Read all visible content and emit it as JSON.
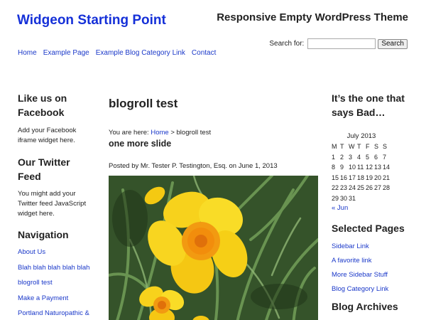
{
  "header": {
    "site_title": "Widgeon Starting Point",
    "tagline": "Responsive Empty WordPress Theme"
  },
  "search": {
    "label": "Search for:",
    "placeholder": "",
    "button_label": "Search"
  },
  "nav": {
    "items": [
      "Home",
      "Example Page",
      "Example Blog Category Link",
      "Contact"
    ]
  },
  "left_sidebar": {
    "facebook_title": "Like us on Facebook",
    "facebook_text": "Add your Facebook iframe widget here.",
    "twitter_title": "Our Twitter Feed",
    "twitter_text": "You might add your Twitter feed JavaScript widget here.",
    "navigation_title": "Navigation",
    "navigation_items": [
      "About Us",
      "Blah blah blah blah blah",
      "blogroll test",
      "Make a Payment",
      "Portland Naturopathic &"
    ]
  },
  "main": {
    "page_title": "blogroll test",
    "breadcrumb_prefix": "You are here: ",
    "breadcrumb_home": "Home",
    "breadcrumb_rest": " > blogroll test",
    "entry_title": "one more slide",
    "byline": "Posted by Mr. Tester P. Testington, Esq. on June 1, 2013"
  },
  "right_sidebar": {
    "calendar_title": "It’s the one that says Bad…",
    "calendar_caption": "July 2013",
    "calendar_days": [
      "M",
      "T",
      "W",
      "T",
      "F",
      "S",
      "S"
    ],
    "calendar_rows": [
      [
        "1",
        "2",
        "3",
        "4",
        "5",
        "6",
        "7"
      ],
      [
        "8",
        "9",
        "10",
        "11",
        "12",
        "13",
        "14"
      ],
      [
        "15",
        "16",
        "17",
        "18",
        "19",
        "20",
        "21"
      ],
      [
        "22",
        "23",
        "24",
        "25",
        "26",
        "27",
        "28"
      ],
      [
        "29",
        "30",
        "31",
        "",
        "",
        "",
        ""
      ]
    ],
    "calendar_prev": "« Jun",
    "selected_title": "Selected Pages",
    "selected_items": [
      "Sidebar Link",
      "A favorite link",
      "More Sidebar Stuff",
      "Blog Category Link"
    ],
    "archives_title": "Blog Archives"
  },
  "colors": {
    "link": "#1a38c9",
    "title": "#1530d8",
    "text": "#222222"
  }
}
